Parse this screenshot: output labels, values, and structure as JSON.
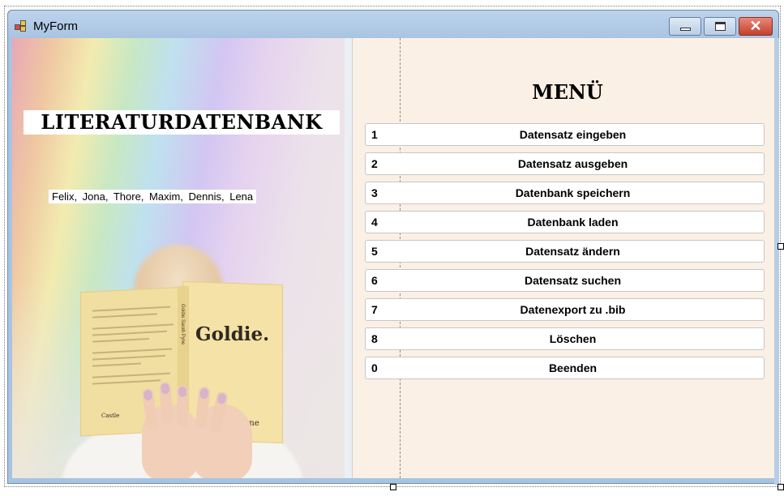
{
  "window": {
    "title": "MyForm",
    "accent": "#a8c4e2",
    "controls": [
      "minimize-icon",
      "maximize-icon",
      "close-icon"
    ]
  },
  "left_panel": {
    "title": "LITERATURDATENBANK",
    "authors": "Felix,  Jona,  Thore, Maxim, Dennis, Lena",
    "book": {
      "title": "Goldie.",
      "author": "Pyne",
      "spine": "Goldie   Sarah Pyne",
      "publisher": "Castle"
    }
  },
  "menu": {
    "title": "MENÜ",
    "items": [
      {
        "key": "1",
        "label": "Datensatz eingeben"
      },
      {
        "key": "2",
        "label": "Datensatz ausgeben"
      },
      {
        "key": "3",
        "label": "Datenbank speichern"
      },
      {
        "key": "4",
        "label": "Datenbank laden"
      },
      {
        "key": "5",
        "label": "Datensatz ändern"
      },
      {
        "key": "6",
        "label": "Datensatz suchen"
      },
      {
        "key": "7",
        "label": "Datenexport zu .bib"
      },
      {
        "key": "8",
        "label": "Löschen"
      },
      {
        "key": "0",
        "label": "Beenden"
      }
    ]
  },
  "colors": {
    "client_background": "#fbf0e5",
    "button_background": "#ffffff",
    "close_button": "#c2412e"
  }
}
